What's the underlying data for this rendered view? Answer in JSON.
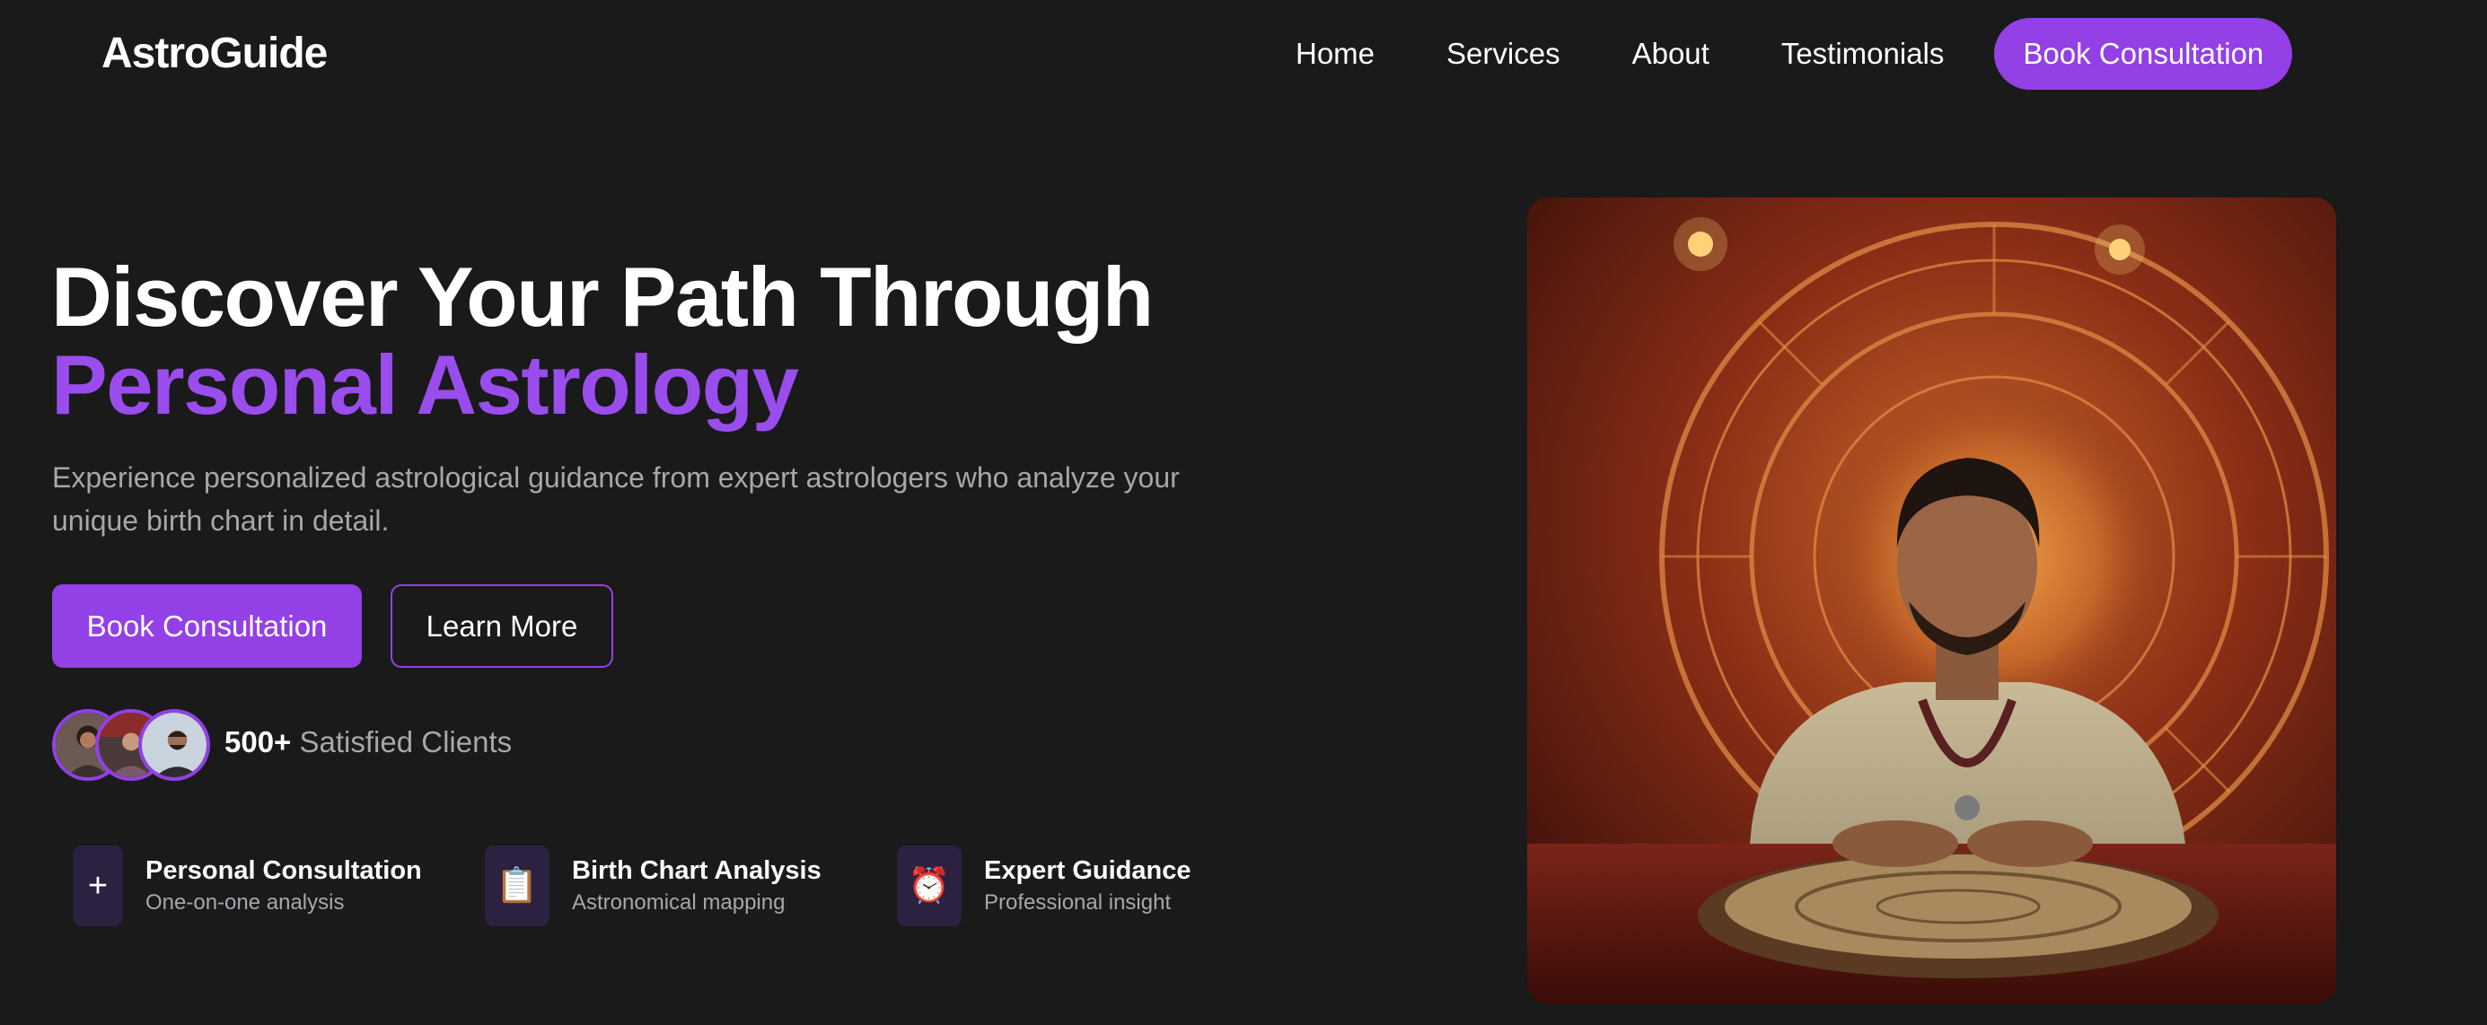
{
  "brand": {
    "name": "AstroGuide"
  },
  "nav": {
    "links": [
      "Home",
      "Services",
      "About",
      "Testimonials"
    ],
    "cta": "Book Consultation"
  },
  "hero": {
    "title_line1": "Discover Your Path Through",
    "title_line2": "Personal Astrology",
    "subtitle": "Experience personalized astrological guidance from expert astrologers who analyze your unique birth chart in detail.",
    "primary_button": "Book Consultation",
    "secondary_button": "Learn More"
  },
  "clients": {
    "count": "500+",
    "label": "Satisfied Clients"
  },
  "features": [
    {
      "icon": "plus-icon",
      "glyph": "+",
      "title": "Personal Consultation",
      "subtitle": "One-on-one analysis"
    },
    {
      "icon": "clipboard-icon",
      "glyph": "📋",
      "title": "Birth Chart Analysis",
      "subtitle": "Astronomical mapping"
    },
    {
      "icon": "alarm-clock-icon",
      "glyph": "⏰",
      "title": "Expert Guidance",
      "subtitle": "Professional insight"
    }
  ],
  "colors": {
    "background": "#1a1a1a",
    "accent": "#9340e6",
    "accent_text": "#9a4ded",
    "muted_text": "#a6a6ad",
    "feature_icon_bg": "#2c2140"
  }
}
